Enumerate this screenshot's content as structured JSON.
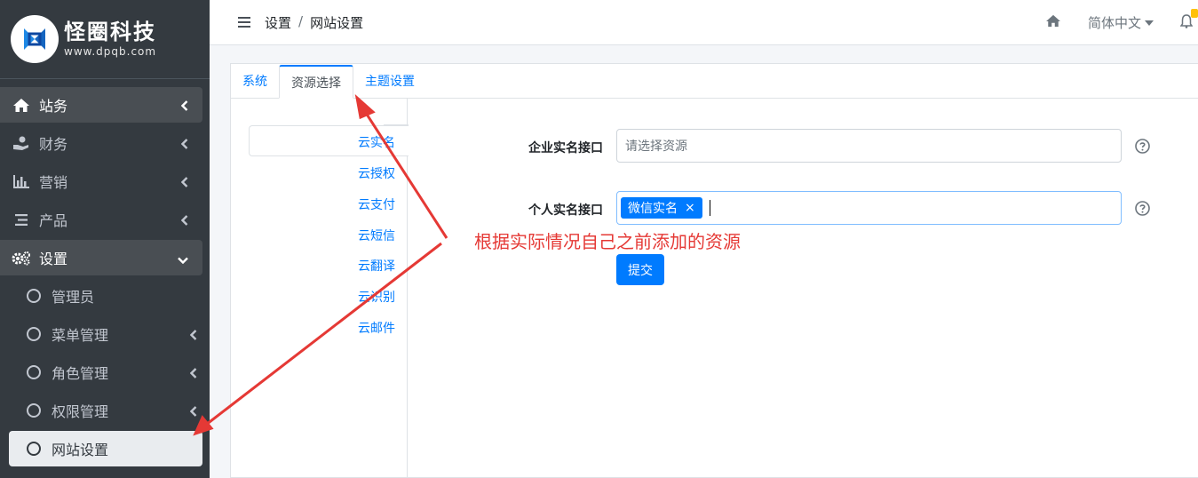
{
  "brand": {
    "title": "怪圈科技",
    "subtitle": "www.dpqb.com"
  },
  "sidebar": {
    "items": [
      {
        "label": "站务",
        "icon": "home-icon"
      },
      {
        "label": "财务",
        "icon": "hand-coin-icon"
      },
      {
        "label": "营销",
        "icon": "bar-chart-icon"
      },
      {
        "label": "产品",
        "icon": "list-icon"
      },
      {
        "label": "设置",
        "icon": "gears-icon"
      }
    ],
    "sub_items": [
      {
        "label": "管理员"
      },
      {
        "label": "菜单管理"
      },
      {
        "label": "角色管理"
      },
      {
        "label": "权限管理"
      },
      {
        "label": "网站设置"
      }
    ]
  },
  "topbar": {
    "breadcrumb": [
      "设置",
      "网站设置"
    ],
    "breadcrumb_sep": "/",
    "language": "简体中文"
  },
  "tabs": [
    "系统",
    "资源选择",
    "主题设置"
  ],
  "resource_nav": [
    "云实名",
    "云授权",
    "云支付",
    "云短信",
    "云翻译",
    "云识别",
    "云邮件"
  ],
  "form": {
    "enterprise_label": "企业实名接口",
    "enterprise_placeholder": "请选择资源",
    "personal_label": "个人实名接口",
    "personal_tag": "微信实名",
    "tag_remove": "×",
    "submit": "提交"
  },
  "annotation": {
    "text": "根据实际情况自己之前添加的资源",
    "color": "#e53935"
  },
  "colors": {
    "sidebar_bg": "#343a40",
    "accent": "#007bff",
    "annotation": "#e53935"
  }
}
